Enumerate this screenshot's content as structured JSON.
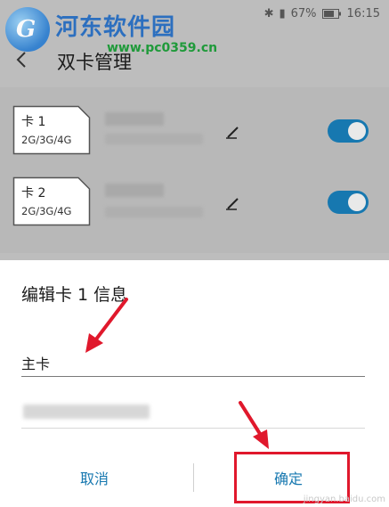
{
  "watermark": {
    "logo_letter": "G",
    "title": "河东软件园",
    "url": "www.pc0359.cn",
    "corner_text": "jingyan.baidu.com"
  },
  "status_bar": {
    "battery": "67%",
    "time": "16:15"
  },
  "nav": {
    "title": "双卡管理"
  },
  "sim_cards": [
    {
      "name": "卡 1",
      "network": "2G/3G/4G",
      "enabled": true
    },
    {
      "name": "卡 2",
      "network": "2G/3G/4G",
      "enabled": true
    }
  ],
  "dialog": {
    "title": "编辑卡 1 信息",
    "name_value": "主卡",
    "cancel_label": "取消",
    "ok_label": "确定"
  },
  "colors": {
    "accent": "#1778b0",
    "annotation": "#e0182c"
  }
}
